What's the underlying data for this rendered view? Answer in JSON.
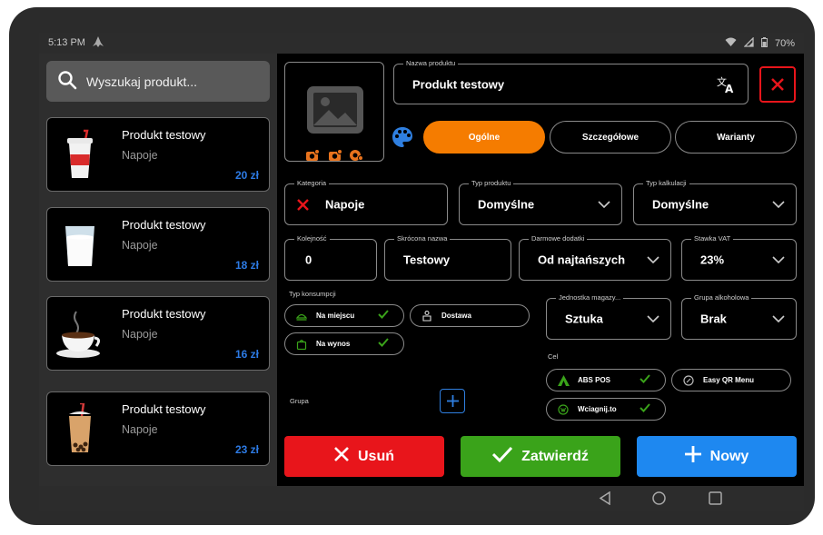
{
  "status": {
    "time": "5:13 PM",
    "battery": "70%"
  },
  "search": {
    "placeholder": "Wyszukaj produkt..."
  },
  "products": [
    {
      "name": "Produkt testowy",
      "category": "Napoje",
      "price": "20 zł",
      "icon": "soda-cup-icon"
    },
    {
      "name": "Produkt testowy",
      "category": "Napoje",
      "price": "18 zł",
      "icon": "milk-glass-icon"
    },
    {
      "name": "Produkt testowy",
      "category": "Napoje",
      "price": "16 zł",
      "icon": "coffee-cup-icon"
    },
    {
      "name": "Produkt testowy",
      "category": "Napoje",
      "price": "23 zł",
      "icon": "bubble-tea-icon"
    }
  ],
  "form": {
    "name_label": "Nazwa produktu",
    "name_value": "Produkt testowy",
    "tabs": [
      "Ogólne",
      "Szczegółowe",
      "Warianty"
    ],
    "category_label": "Kategoria",
    "category_value": "Napoje",
    "product_type_label": "Typ produktu",
    "product_type_value": "Domyślne",
    "calc_type_label": "Typ kalkulacji",
    "calc_type_value": "Domyślne",
    "order_label": "Kolejność",
    "order_value": "0",
    "short_name_label": "Skrócona nazwa",
    "short_name_value": "Testowy",
    "free_addons_label": "Darmowe dodatki",
    "free_addons_value": "Od najtańszych",
    "vat_label": "Stawka VAT",
    "vat_value": "23%",
    "consumption_label": "Typ konsumpcji",
    "consumption": [
      "Na miejscu",
      "Dostawa",
      "Na wynos"
    ],
    "unit_label": "Jednostka magazy...",
    "unit_value": "Sztuka",
    "alcohol_label": "Grupa alkoholowa",
    "alcohol_value": "Brak",
    "target_label": "Cel",
    "targets": [
      "ABS POS",
      "Easy QR Menu",
      "Wciagnij.to"
    ],
    "group_label": "Grupa"
  },
  "actions": {
    "delete": "Usuń",
    "confirm": "Zatwierdź",
    "new": "Nowy"
  },
  "colors": {
    "orange": "#f57c00",
    "red": "#e8151b",
    "green": "#3aa31a",
    "blue": "#1e88f0",
    "price_blue": "#2d7be5"
  }
}
